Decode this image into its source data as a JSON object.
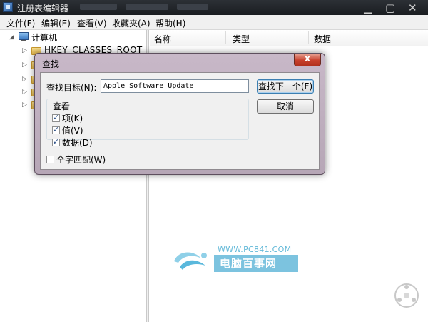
{
  "window": {
    "title": "注册表编辑器"
  },
  "menu": [
    "文件(F)",
    "编辑(E)",
    "查看(V)",
    "收藏夹(A)",
    "帮助(H)"
  ],
  "tree": {
    "root_label": "计算机",
    "first_key": "HKEY_CLASSES_ROOT"
  },
  "list": {
    "columns": [
      "名称",
      "类型",
      "数据"
    ]
  },
  "dialog": {
    "title": "查找",
    "close_symbol": "x",
    "find_label": "查找目标(N):",
    "find_value": "Apple Software Update",
    "find_next_label": "查找下一个(F)",
    "cancel_label": "取消",
    "look_at_title": "查看",
    "look_at": [
      {
        "label": "项(K)",
        "checked": true
      },
      {
        "label": "值(V)",
        "checked": true
      },
      {
        "label": "数据(D)",
        "checked": true
      }
    ],
    "match_whole": {
      "label": "全字匹配(W)",
      "checked": false
    }
  },
  "watermark": {
    "url": "WWW.PC841.COM",
    "name": "电脑百事网"
  }
}
